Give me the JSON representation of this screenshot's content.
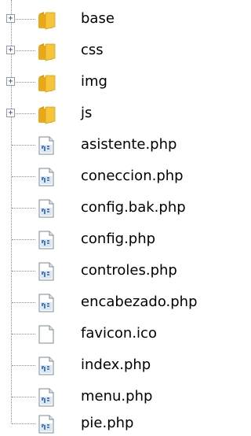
{
  "tree": {
    "items": [
      {
        "label": "base",
        "kind": "folder",
        "expander": "+"
      },
      {
        "label": "css",
        "kind": "folder",
        "expander": "+"
      },
      {
        "label": "img",
        "kind": "folder",
        "expander": "+"
      },
      {
        "label": "js",
        "kind": "folder",
        "expander": "+"
      },
      {
        "label": "asistente.php",
        "kind": "php"
      },
      {
        "label": "coneccion.php",
        "kind": "php"
      },
      {
        "label": "config.bak.php",
        "kind": "php"
      },
      {
        "label": "config.php",
        "kind": "php"
      },
      {
        "label": "controles.php",
        "kind": "php"
      },
      {
        "label": "encabezado.php",
        "kind": "php"
      },
      {
        "label": "favicon.ico",
        "kind": "file"
      },
      {
        "label": "index.php",
        "kind": "php"
      },
      {
        "label": "menu.php",
        "kind": "php"
      },
      {
        "label": "pie.php",
        "kind": "php"
      }
    ]
  },
  "icons": {
    "folder": "folder-icon",
    "php": "php-file-icon",
    "file": "blank-file-icon"
  },
  "colors": {
    "folder": "#f5bd2c",
    "php_badge": "#2d5fa0",
    "tree_line": "#8c8c8c"
  }
}
